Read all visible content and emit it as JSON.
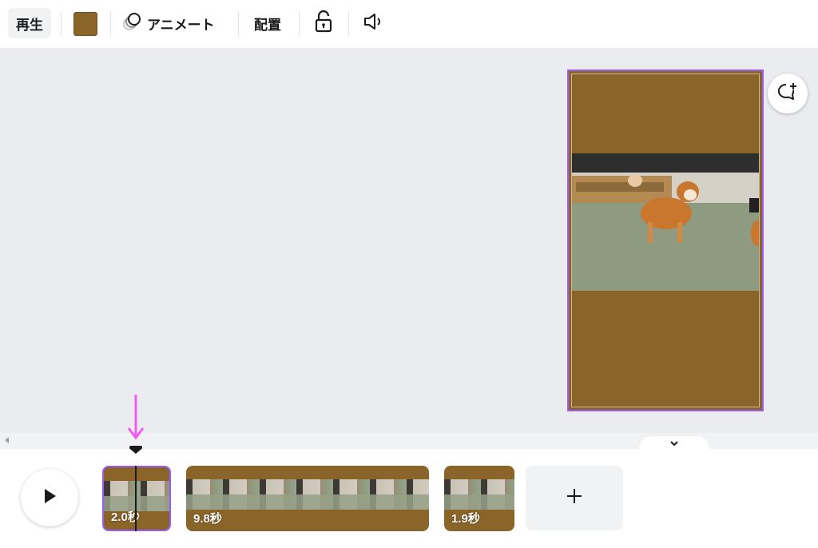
{
  "toolbar": {
    "play_label": "再生",
    "color_swatch": "#8a6428",
    "animate_label": "アニメート",
    "layout_label": "配置",
    "lock_icon": "unlocked-padlock-icon",
    "audio_icon": "speaker-icon"
  },
  "canvas": {
    "page_background": "#8a6428",
    "selection_color": "#9b5cf6",
    "comment_icon": "add-comment-icon"
  },
  "timeline": {
    "play_icon": "play-icon",
    "clips": [
      {
        "duration": "2.0秒",
        "selected": true
      },
      {
        "duration": "9.8秒",
        "selected": false
      },
      {
        "duration": "1.9秒",
        "selected": false
      }
    ],
    "add_icon": "plus-icon",
    "annotation_color": "#f05cf0"
  }
}
